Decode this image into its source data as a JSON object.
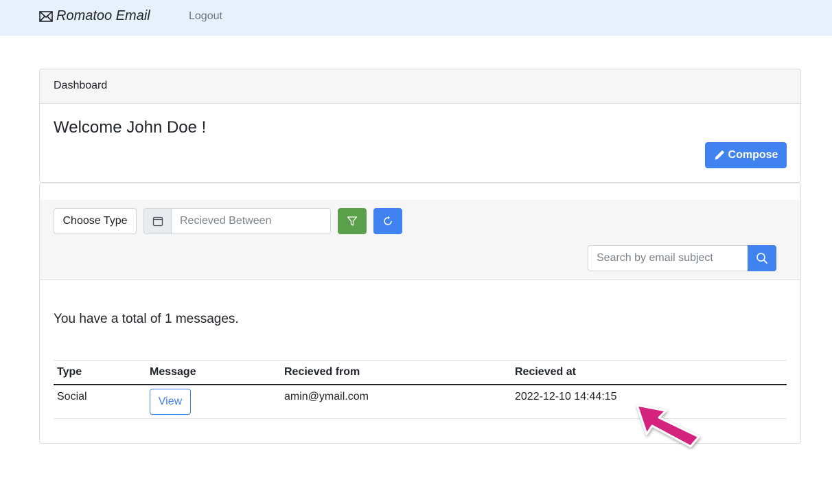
{
  "navbar": {
    "brand": "Romatoo Email",
    "logout": "Logout"
  },
  "dashboard": {
    "header": "Dashboard",
    "welcome": "Welcome John Doe !",
    "compose_label": "Compose"
  },
  "filters": {
    "choose_type": "Choose Type",
    "date_placeholder": "Recieved Between",
    "search_placeholder": "Search by email subject"
  },
  "messages": {
    "total_text": "You have a total of 1 messages.",
    "columns": [
      "Type",
      "Message",
      "Recieved from",
      "Recieved at"
    ],
    "rows": [
      {
        "type": "Social",
        "action": "View",
        "from": "amin@ymail.com",
        "at": "2022-12-10 14:44:15"
      }
    ]
  },
  "colors": {
    "navbar_bg": "#e7f1fc",
    "primary": "#3f82f0",
    "success": "#5aa04a",
    "annotation_arrow": "#d4237f"
  }
}
